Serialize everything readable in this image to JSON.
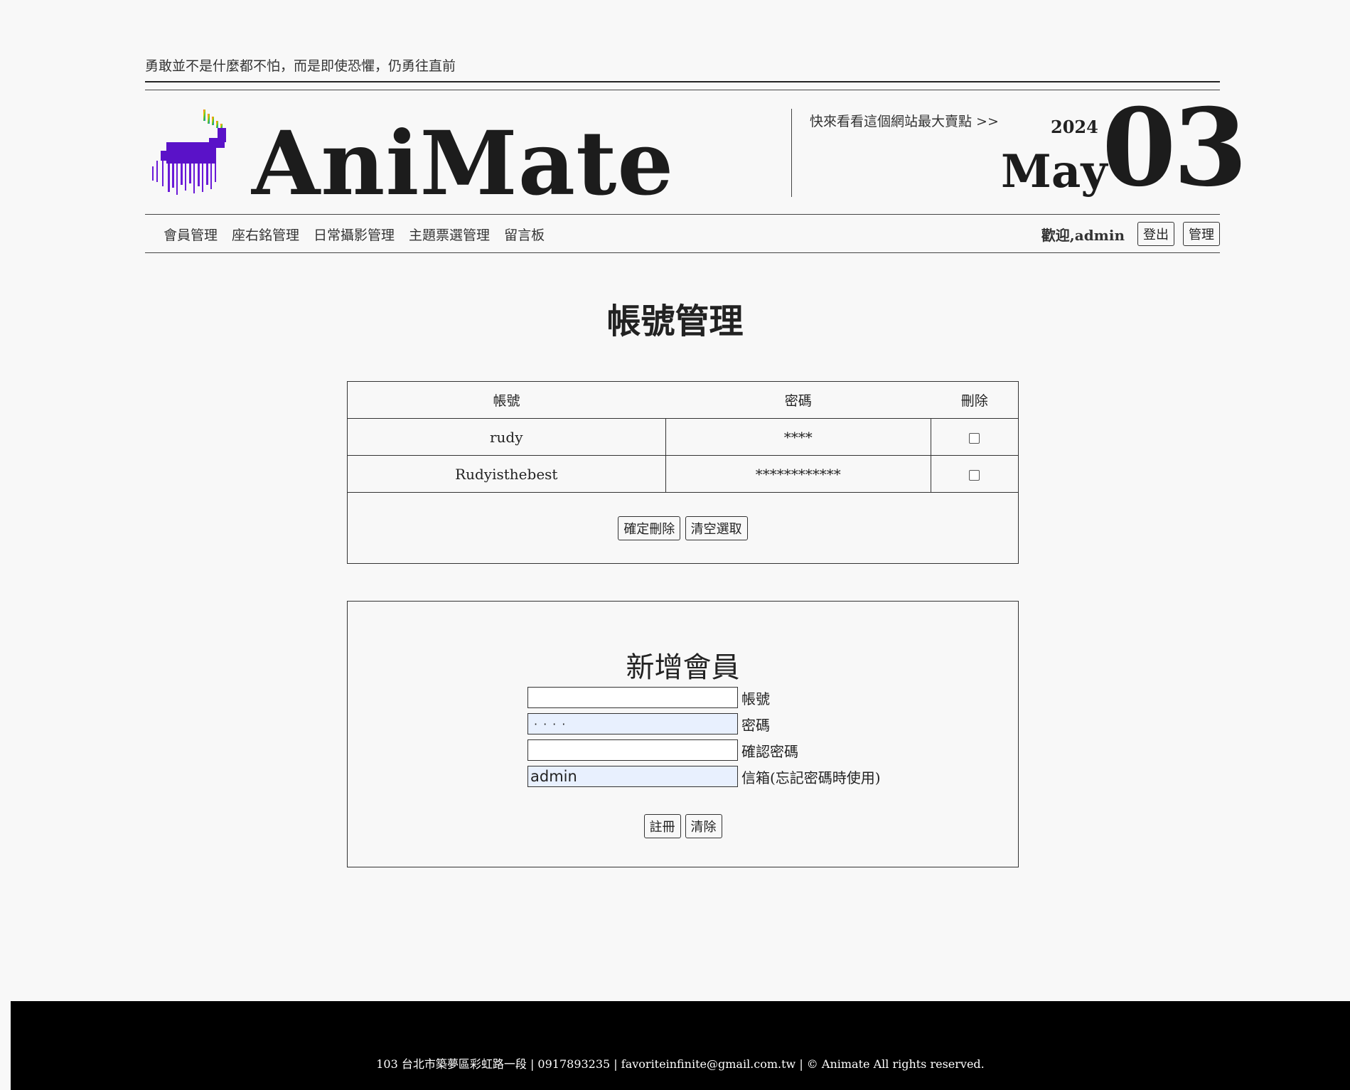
{
  "header": {
    "motto": "勇敢並不是什麼都不怕，而是即使恐懼，仍勇往直前",
    "brand": "AniMate",
    "promo_link": "快來看看這個網站最大賣點 >>",
    "date": {
      "year": "2024",
      "month": "May",
      "day": "03"
    },
    "nav": [
      "會員管理",
      "座右銘管理",
      "日常攝影管理",
      "主題票選管理",
      "留言板"
    ],
    "welcome": "歡迎,admin",
    "logout_label": "登出",
    "manage_label": "管理"
  },
  "main": {
    "title": "帳號管理",
    "table": {
      "headers": [
        "帳號",
        "密碼",
        "刪除"
      ],
      "rows": [
        {
          "account": "rudy",
          "password": "****"
        },
        {
          "account": "Rudyisthebest",
          "password": "************"
        }
      ],
      "confirm_delete_label": "確定刪除",
      "clear_selection_label": "清空選取"
    },
    "register": {
      "title": "新增會員",
      "fields": [
        {
          "label": "帳號",
          "value": ""
        },
        {
          "label": "密碼",
          "value": "····"
        },
        {
          "label": "確認密碼",
          "value": ""
        },
        {
          "label": "信箱(忘記密碼時使用)",
          "value": "admin"
        }
      ],
      "submit_label": "註冊",
      "reset_label": "清除"
    }
  },
  "footer": {
    "text": "103 台北市築夢區彩虹路一段 | 0917893235 | favoriteinfinite@gmail.com.tw | © Animate All rights reserved."
  },
  "colors": {
    "background": "#f8f8f8",
    "footer": "#000000",
    "autofill": "#e8f0fe"
  }
}
